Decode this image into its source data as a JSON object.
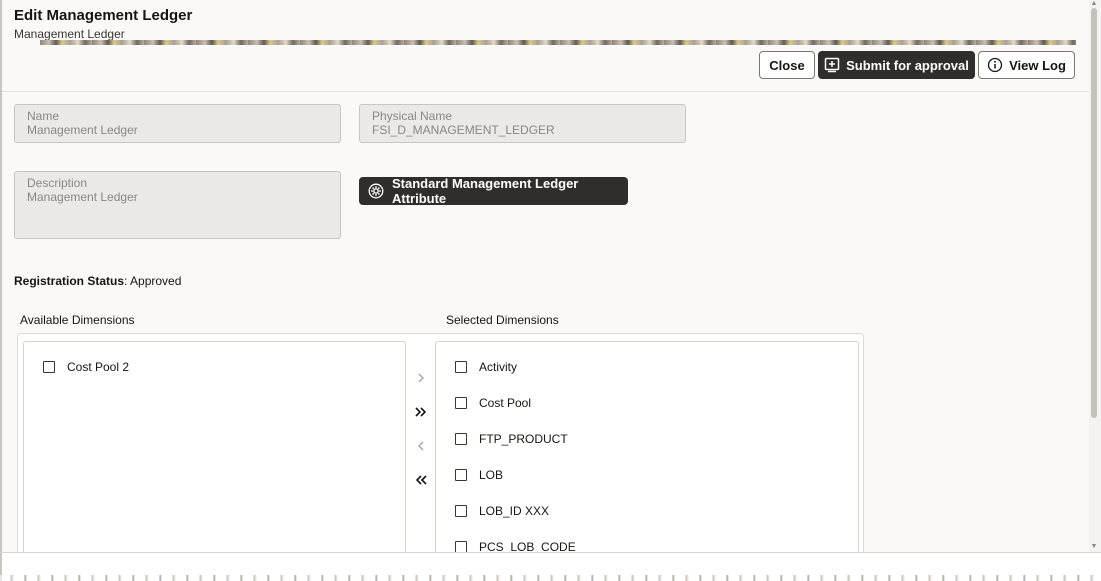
{
  "dialog": {
    "title": "Edit Management Ledger",
    "subtitle": "Management Ledger"
  },
  "toolbar": {
    "close_label": "Close",
    "submit_label": "Submit for approval",
    "view_log_label": "View Log"
  },
  "form": {
    "name": {
      "label": "Name",
      "value": "Management Ledger"
    },
    "physical_name": {
      "label": "Physical Name",
      "value": "FSI_D_MANAGEMENT_LEDGER"
    },
    "description": {
      "label": "Description",
      "value": "Management Ledger"
    },
    "attribute_button_label": "Standard Management Ledger Attribute"
  },
  "registration": {
    "label": "Registration Status",
    "value": ": Approved"
  },
  "dimensions": {
    "available_label": "Available Dimensions",
    "selected_label": "Selected Dimensions",
    "available": [
      "Cost Pool 2"
    ],
    "selected": [
      "Activity",
      "Cost Pool",
      "FTP_PRODUCT",
      "LOB",
      "LOB_ID XXX",
      "PCS_LOB_CODE"
    ]
  },
  "icons": {
    "submit": "add-document-icon",
    "view_log": "info-icon",
    "attribute": "gear-icon",
    "move_right": "chevron-right-icon",
    "move_all_right": "double-chevron-right-icon",
    "move_left": "chevron-left-icon",
    "move_all_left": "double-chevron-left-icon"
  },
  "colors": {
    "primary_button": "#312d2a",
    "background": "#fbf9f8",
    "field_fill": "#ebe9e7"
  }
}
